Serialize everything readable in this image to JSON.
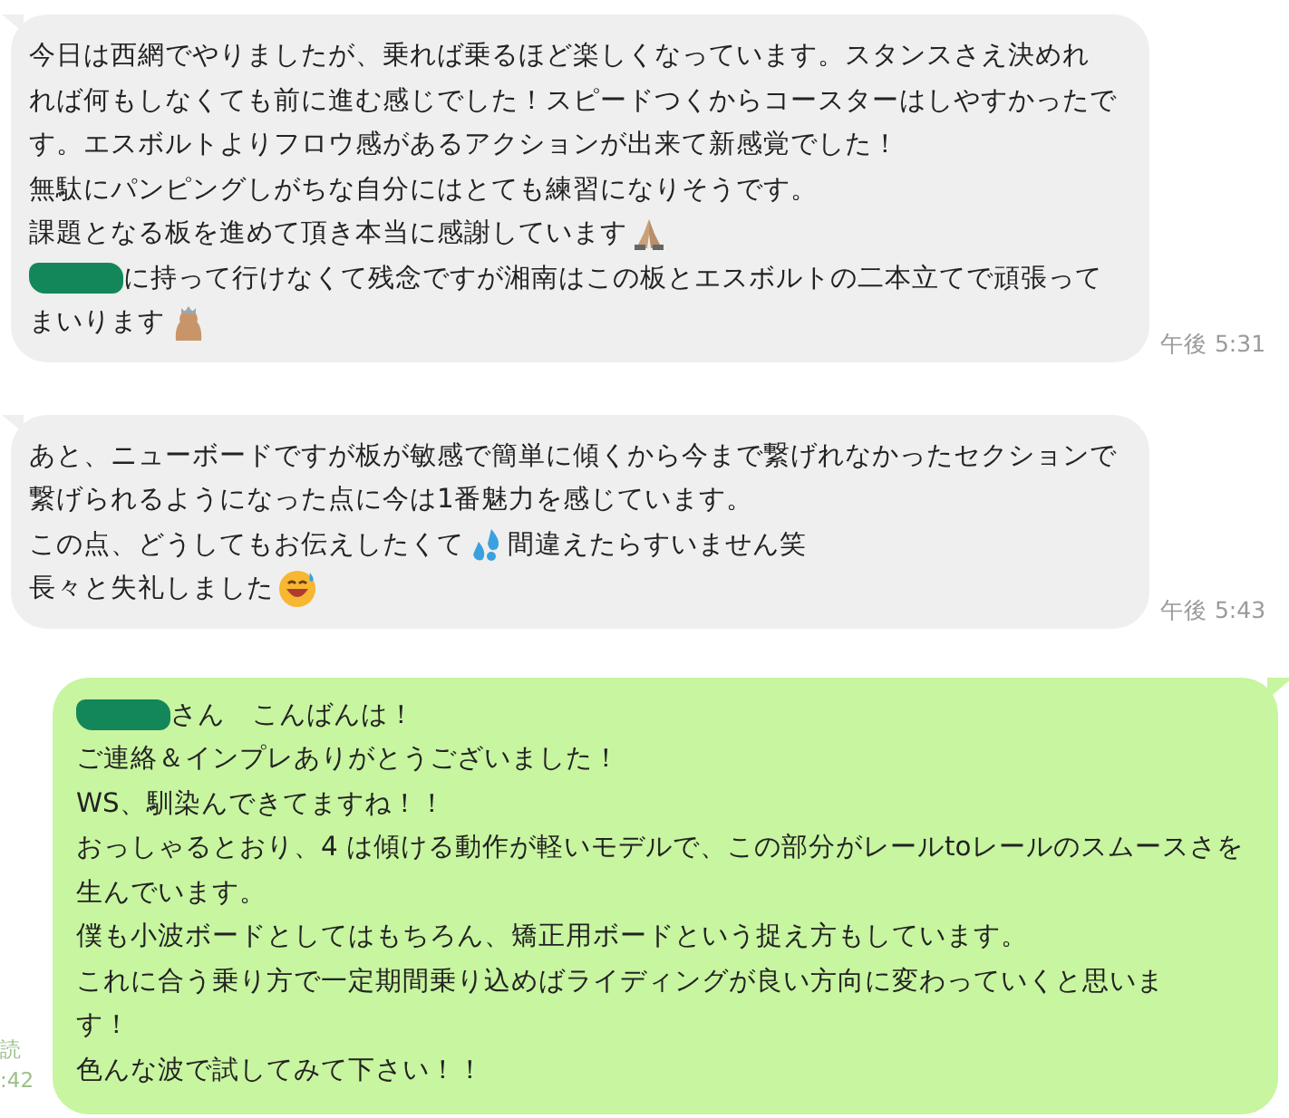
{
  "messages": [
    {
      "kind": "incoming",
      "time": "午後 5:31",
      "lines": [
        [
          {
            "kind": "text",
            "text": "今日は西網でやりましたが、乗れば乗るほど楽しくなっています。スタンスさえ決めれ"
          }
        ],
        [
          {
            "kind": "text",
            "text": "れば何もしなくても前に進む感じでした！スピードつくからコースターはしやすかったで"
          }
        ],
        [
          {
            "kind": "text",
            "text": "す。エスボルトよりフロウ感があるアクションが出来て新感覚でした！"
          }
        ],
        [
          {
            "kind": "text",
            "text": "無駄にパンピングしがちな自分にはとても練習になりそうです。"
          }
        ],
        [
          {
            "kind": "text",
            "text": "課題となる板を進めて頂き本当に感謝しています"
          },
          {
            "kind": "pray"
          }
        ],
        [
          {
            "kind": "redaction"
          },
          {
            "kind": "text",
            "text": "に持って行けなくて残念ですが湘南はこの板とエスボルトの二本立てで頑張って"
          }
        ],
        [
          {
            "kind": "text",
            "text": "まいります"
          },
          {
            "kind": "figure"
          }
        ]
      ]
    },
    {
      "kind": "incoming",
      "time": "午後 5:43",
      "lines": [
        [
          {
            "kind": "text",
            "text": "あと、ニューボードですが板が敏感で簡単に傾くから今まで繋げれなかったセクションで"
          }
        ],
        [
          {
            "kind": "text",
            "text": "繋げられるようになった点に今は1番魅力を感じています。"
          }
        ],
        [
          {
            "kind": "text",
            "text": "この点、どうしてもお伝えしたくて"
          },
          {
            "kind": "drops"
          },
          {
            "kind": "text",
            "text": "間違えたらすいません笑"
          }
        ],
        [
          {
            "kind": "text",
            "text": "長々と失礼しました"
          },
          {
            "kind": "grin"
          }
        ]
      ]
    },
    {
      "kind": "outgoing",
      "read": "読",
      "time": ":42",
      "lines": [
        [
          {
            "kind": "redaction"
          },
          {
            "kind": "text",
            "text": "さん　こんばんは！"
          }
        ],
        [
          {
            "kind": "text",
            "text": "ご連絡＆インプレありがとうございました！"
          }
        ],
        [
          {
            "kind": "text",
            "text": "WS、馴染んできてますね！！"
          }
        ],
        [
          {
            "kind": "text",
            "text": "おっしゃるとおり、4 は傾ける動作が軽いモデルで、この部分がレールtoレールのスムースさを"
          }
        ],
        [
          {
            "kind": "text",
            "text": "生んでいます。"
          }
        ],
        [
          {
            "kind": "text",
            "text": "僕も小波ボードとしてはもちろん、矯正用ボードという捉え方もしています。"
          }
        ],
        [
          {
            "kind": "text",
            "text": "これに合う乗り方で一定期間乗り込めばライディングが良い方向に変わっていくと思いま"
          }
        ],
        [
          {
            "kind": "text",
            "text": "す！"
          }
        ],
        [
          {
            "kind": "text",
            "text": "色んな波で試してみて下さい！！"
          }
        ]
      ]
    }
  ]
}
